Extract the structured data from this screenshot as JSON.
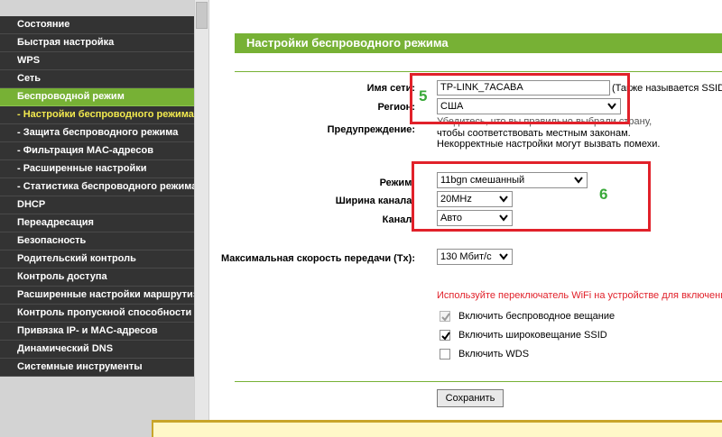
{
  "sidebar": {
    "items": [
      {
        "label": "Состояние",
        "type": "main",
        "active": false
      },
      {
        "label": "Быстрая настройка",
        "type": "main",
        "active": false
      },
      {
        "label": "WPS",
        "type": "main",
        "active": false
      },
      {
        "label": "Сеть",
        "type": "main",
        "active": false
      },
      {
        "label": "Беспроводной режим",
        "type": "main",
        "active": true
      },
      {
        "label": "- Настройки беспроводного режима",
        "type": "sub",
        "active": true
      },
      {
        "label": "- Защита беспроводного режима",
        "type": "sub",
        "active": false
      },
      {
        "label": "- Фильтрация MAC-адресов",
        "type": "sub",
        "active": false
      },
      {
        "label": "- Расширенные настройки",
        "type": "sub",
        "active": false
      },
      {
        "label": "- Статистика беспроводного режима",
        "type": "sub",
        "active": false
      },
      {
        "label": "DHCP",
        "type": "main",
        "active": false
      },
      {
        "label": "Переадресация",
        "type": "main",
        "active": false
      },
      {
        "label": "Безопасность",
        "type": "main",
        "active": false
      },
      {
        "label": "Родительский контроль",
        "type": "main",
        "active": false
      },
      {
        "label": "Контроль доступа",
        "type": "main",
        "active": false
      },
      {
        "label": "Расширенные настройки маршрутизации",
        "type": "main",
        "active": false
      },
      {
        "label": "Контроль пропускной способности",
        "type": "main",
        "active": false
      },
      {
        "label": "Привязка IP- и MAC-адресов",
        "type": "main",
        "active": false
      },
      {
        "label": "Динамический DNS",
        "type": "main",
        "active": false
      },
      {
        "label": "Системные инструменты",
        "type": "main",
        "active": false
      }
    ]
  },
  "main": {
    "title": "Настройки беспроводного режима",
    "ssid": {
      "label": "Имя сети:",
      "value": "TP-LINK_7ACABA",
      "hint": "(Также называется SSID)"
    },
    "region": {
      "label": "Регион:",
      "value": "США"
    },
    "warning": {
      "label": "Предупреждение:",
      "lines": [
        "Убедитесь, что вы правильно выбрали страну,",
        "чтобы соответствовать местным законам.",
        "Некорректные настройки могут вызвать помехи."
      ]
    },
    "mode": {
      "label": "Режим:",
      "value": "11bgn смешанный"
    },
    "channel_width": {
      "label": "Ширина канала:",
      "value": "20MHz"
    },
    "channel": {
      "label": "Канал:",
      "value": "Авто"
    },
    "tx_rate": {
      "label": "Максимальная скорость передачи (Tx):",
      "value": "130 Мбит/с"
    },
    "notice": "Используйте переключатель WiFi на устройстве для включения/отк",
    "checkboxes": [
      {
        "label": "Включить беспроводное вещание",
        "checked": true,
        "disabled": true
      },
      {
        "label": "Включить широковещание SSID",
        "checked": true,
        "disabled": false
      },
      {
        "label": "Включить WDS",
        "checked": false,
        "disabled": false
      }
    ],
    "save_label": "Сохранить"
  },
  "annotations": {
    "box5": "5",
    "box6": "6"
  },
  "colors": {
    "accent_green": "#77b135",
    "sidebar_dark": "#333333",
    "highlight_red": "#e1212a",
    "notice_red": "#e1212a",
    "number_green": "#39a939"
  }
}
